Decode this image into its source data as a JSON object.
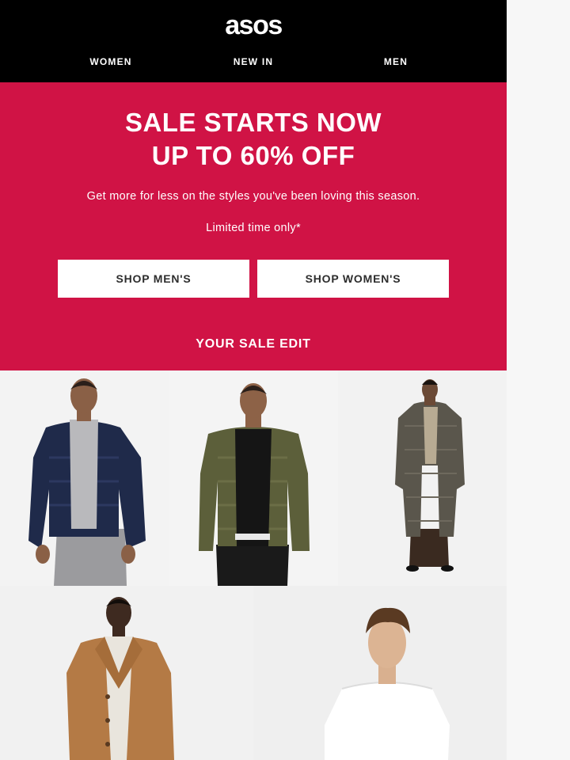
{
  "header": {
    "logo": "asos",
    "nav": [
      {
        "label": "WOMEN"
      },
      {
        "label": "NEW IN"
      },
      {
        "label": "MEN"
      }
    ]
  },
  "banner": {
    "headline_line1": "SALE STARTS NOW",
    "headline_line2": "UP TO 60% OFF",
    "subtext": "Get more for less on the styles you've been loving this season.",
    "note": "Limited time only*",
    "buttons": [
      {
        "label": "SHOP MEN'S"
      },
      {
        "label": "SHOP WOMEN'S"
      }
    ],
    "edit_title": "YOUR SALE EDIT",
    "color": "#d01345"
  },
  "products": [
    {
      "image": "man-navy-puffer-jacket-photo"
    },
    {
      "image": "man-khaki-quilted-jacket-photo"
    },
    {
      "image": "man-long-tweed-coat-photo"
    },
    {
      "image": "man-camel-overcoat-photo"
    },
    {
      "image": "man-white-tshirt-photo"
    }
  ]
}
